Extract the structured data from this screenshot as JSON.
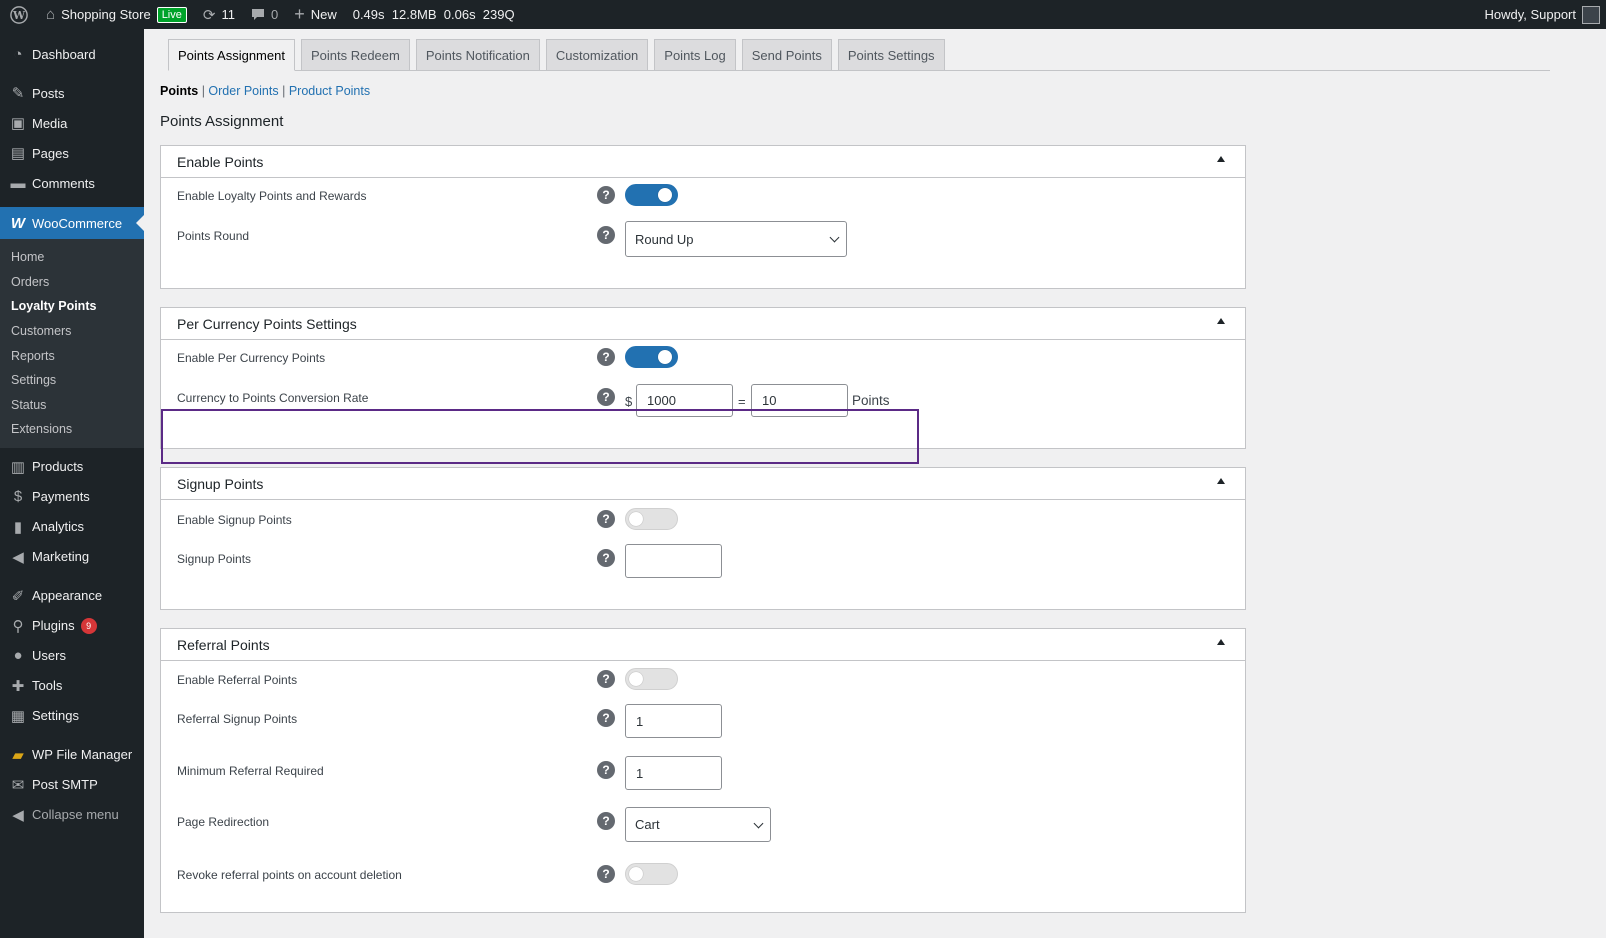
{
  "adminbar": {
    "site_name": "Shopping Store",
    "live_label": "Live",
    "updates_count": "11",
    "comments_count": "0",
    "new_label": "New",
    "perf": "0.49s  12.8MB  0.06s  239Q",
    "howdy": "Howdy, Support"
  },
  "sidebar": {
    "items_top": [
      {
        "label": "Dashboard",
        "icon": "dashboard-icon"
      },
      {
        "label": "Posts",
        "icon": "pin-icon"
      },
      {
        "label": "Media",
        "icon": "media-icon"
      },
      {
        "label": "Pages",
        "icon": "pages-icon"
      },
      {
        "label": "Comments",
        "icon": "comments-icon"
      }
    ],
    "woocommerce_label": "WooCommerce",
    "submenu": [
      "Home",
      "Orders",
      "Loyalty Points",
      "Customers",
      "Reports",
      "Settings",
      "Status",
      "Extensions"
    ],
    "items_bottom": [
      "Products",
      "Payments",
      "Analytics",
      "Marketing",
      "Appearance",
      "Plugins",
      "Users",
      "Tools",
      "Settings",
      "WP File Manager",
      "Post SMTP",
      "Collapse menu"
    ],
    "plugins_badge": "9"
  },
  "tabs": [
    "Points Assignment",
    "Points Redeem",
    "Points Notification",
    "Customization",
    "Points Log",
    "Send Points",
    "Points Settings"
  ],
  "subnav": {
    "current": "Points",
    "sep": "|",
    "link1": "Order Points",
    "link2": "Product Points"
  },
  "page_title": "Points Assignment",
  "panels": {
    "enable_points": {
      "title": "Enable Points",
      "enable_label": "Enable Loyalty Points and Rewards",
      "enable_on": true,
      "round_label": "Points Round",
      "round_value": "Round Up"
    },
    "per_currency": {
      "title": "Per Currency Points Settings",
      "enable_label": "Enable Per Currency Points",
      "enable_on": true,
      "rate_label": "Currency to Points Conversion Rate",
      "currency_symbol": "$",
      "currency_value": "1000",
      "equals": "=",
      "points_value": "10",
      "points_suffix": "Points"
    },
    "signup": {
      "title": "Signup Points",
      "enable_label": "Enable Signup Points",
      "enable_on": false,
      "points_label": "Signup Points",
      "points_value": ""
    },
    "referral": {
      "title": "Referral Points",
      "enable_label": "Enable Referral Points",
      "enable_on": false,
      "signup_label": "Referral Signup Points",
      "signup_value": "1",
      "min_label": "Minimum Referral Required",
      "min_value": "1",
      "redirect_label": "Page Redirection",
      "redirect_value": "Cart",
      "revoke_label": "Revoke referral points on account deletion",
      "revoke_on": false
    }
  },
  "help_symbol": "?",
  "colors": {
    "accent": "#2271b1",
    "highlight": "#5b2a86",
    "badge": "#d63638",
    "live": "#00a32a"
  }
}
